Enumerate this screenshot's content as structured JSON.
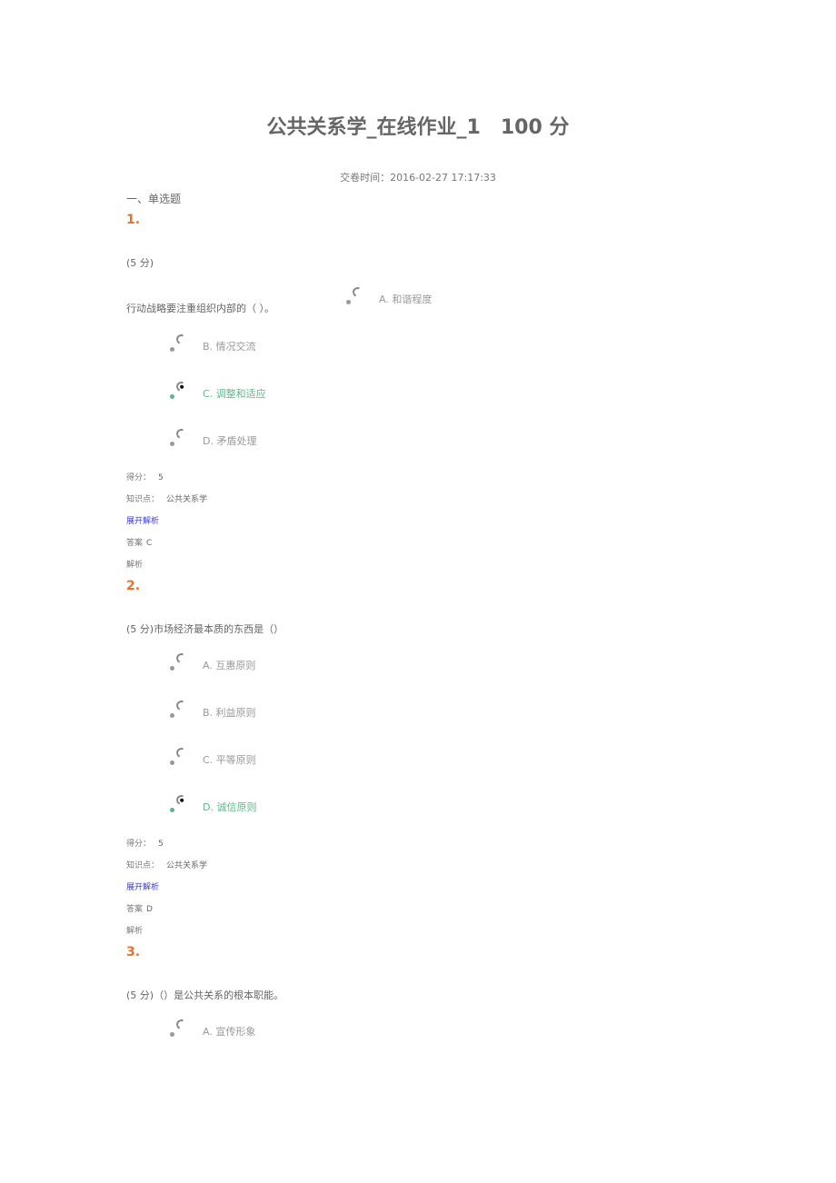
{
  "header": {
    "title": "公共关系学_在线作业_1　100 分",
    "submit_time": "交卷时间：2016-02-27 17:17:33"
  },
  "section_title": "一、单选题",
  "labels": {
    "score": "得分：",
    "knowledge": "知识点：",
    "expand": "展开解析",
    "answer": "答案",
    "analysis": "解析"
  },
  "questions": [
    {
      "number": "1.",
      "points": "(5 分)",
      "text": "行动战略要注重组织内部的（ ）。",
      "options": [
        {
          "letter": "A.",
          "text": "和谐程度",
          "selected": false
        },
        {
          "letter": "B.",
          "text": "情况交流",
          "selected": false
        },
        {
          "letter": "C.",
          "text": "调整和适应",
          "selected": true
        },
        {
          "letter": "D.",
          "text": "矛盾处理",
          "selected": false
        }
      ],
      "score": "5",
      "knowledge": "公共关系学",
      "answer": "C"
    },
    {
      "number": "2.",
      "points": "(5 分)",
      "text": "(5 分)市场经济最本质的东西是（）",
      "options": [
        {
          "letter": "A.",
          "text": "互惠原则",
          "selected": false
        },
        {
          "letter": "B.",
          "text": "利益原则",
          "selected": false
        },
        {
          "letter": "C.",
          "text": "平等原则",
          "selected": false
        },
        {
          "letter": "D.",
          "text": "诚信原则",
          "selected": true
        }
      ],
      "score": "5",
      "knowledge": "公共关系学",
      "answer": "D"
    },
    {
      "number": "3.",
      "points": "(5 分)",
      "text": "(5 分)（）是公共关系的根本职能。",
      "options": [
        {
          "letter": "A.",
          "text": "宣传形象",
          "selected": false
        }
      ]
    }
  ],
  "colors": {
    "accent_orange": "#e8712a",
    "correct_green": "#5cb88a",
    "link_blue": "#3c3cc8"
  }
}
